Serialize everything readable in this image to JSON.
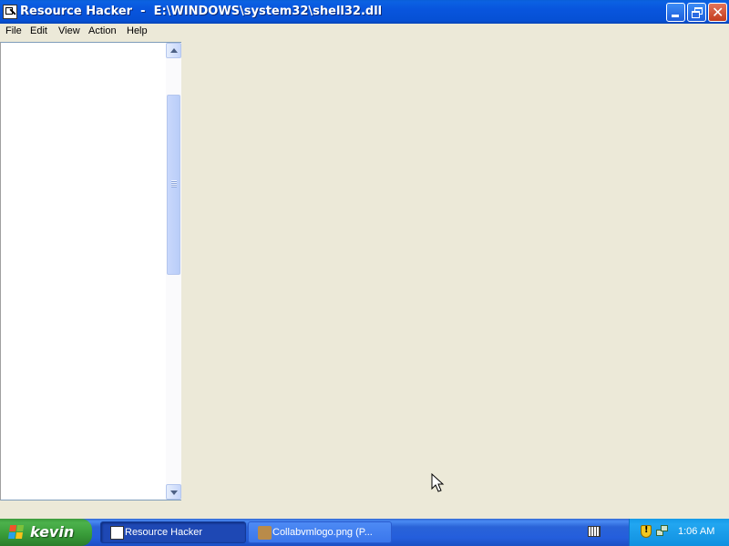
{
  "window": {
    "title": "Resource Hacker  -  E:\\WINDOWS\\system32\\shell32.dll",
    "icon": "resource-hacker-icon"
  },
  "menu": {
    "items": [
      "File",
      "Edit",
      "View",
      "Action",
      "Help"
    ]
  },
  "taskbar": {
    "start_label": "kevin",
    "buttons": [
      {
        "label": "Resource Hacker",
        "icon": "resource-hacker-icon",
        "active": true
      },
      {
        "label": "Collabvmlogo.png (P...",
        "icon": "image-file-icon",
        "active": false
      }
    ],
    "clock": "1:06 AM"
  },
  "colors": {
    "titlebar": "#0855dd",
    "client_bg": "#ece9d8",
    "taskbar": "#245edc",
    "start": "#389a38",
    "tray": "#1090e0"
  }
}
